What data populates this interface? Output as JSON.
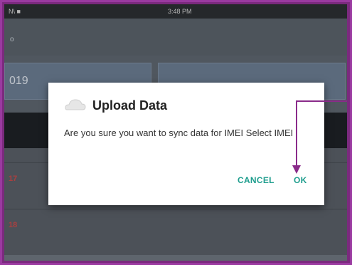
{
  "status": {
    "left_text": "N\\ ■",
    "time": "3:48 PM"
  },
  "appbar": {
    "stub": "o"
  },
  "cards": [
    {
      "date": "019"
    },
    {
      "date": ""
    }
  ],
  "rows": [
    {
      "num": "17",
      "text": ""
    },
    {
      "num": "18",
      "text": ""
    }
  ],
  "dialog": {
    "title": "Upload Data",
    "message": "Are you sure you want to sync data for IMEI Select IMEI",
    "cancel_label": "CANCEL",
    "ok_label": "OK",
    "button_color": "#1f9e8e"
  },
  "annotation": {
    "color": "#8a2b8a"
  }
}
